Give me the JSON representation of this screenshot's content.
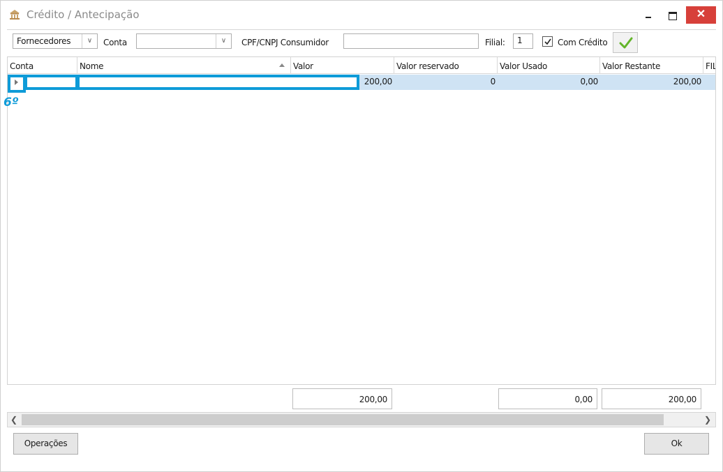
{
  "window": {
    "title": "Crédito / Antecipação",
    "close_glyph": "✕",
    "accent_color": "#0e9bd8"
  },
  "toolbar": {
    "type_combo_value": "Fornecedores",
    "conta_label": "Conta",
    "conta_value": "",
    "cpf_label": "CPF/CNPJ Consumidor",
    "cpf_value": "",
    "filial_label": "Filial:",
    "filial_value": "1",
    "com_credito_label": "Com Crédito",
    "com_credito_checked": true,
    "confirm_icon": "check-icon"
  },
  "grid": {
    "columns": [
      "Conta",
      "Nome",
      "Valor",
      "Valor reservado",
      "Valor Usado",
      "Valor Restante",
      "FIL"
    ],
    "rows": [
      {
        "conta": "",
        "nome": "",
        "valor": "200,00",
        "valor_reservado": "0",
        "valor_usado": "0,00",
        "valor_restante": "200,00"
      }
    ]
  },
  "annotation": "6º",
  "totals": {
    "valor": "200,00",
    "valor_usado": "0,00",
    "valor_restante": "200,00"
  },
  "footer": {
    "operacoes_label": "Operações",
    "ok_label": "Ok"
  }
}
